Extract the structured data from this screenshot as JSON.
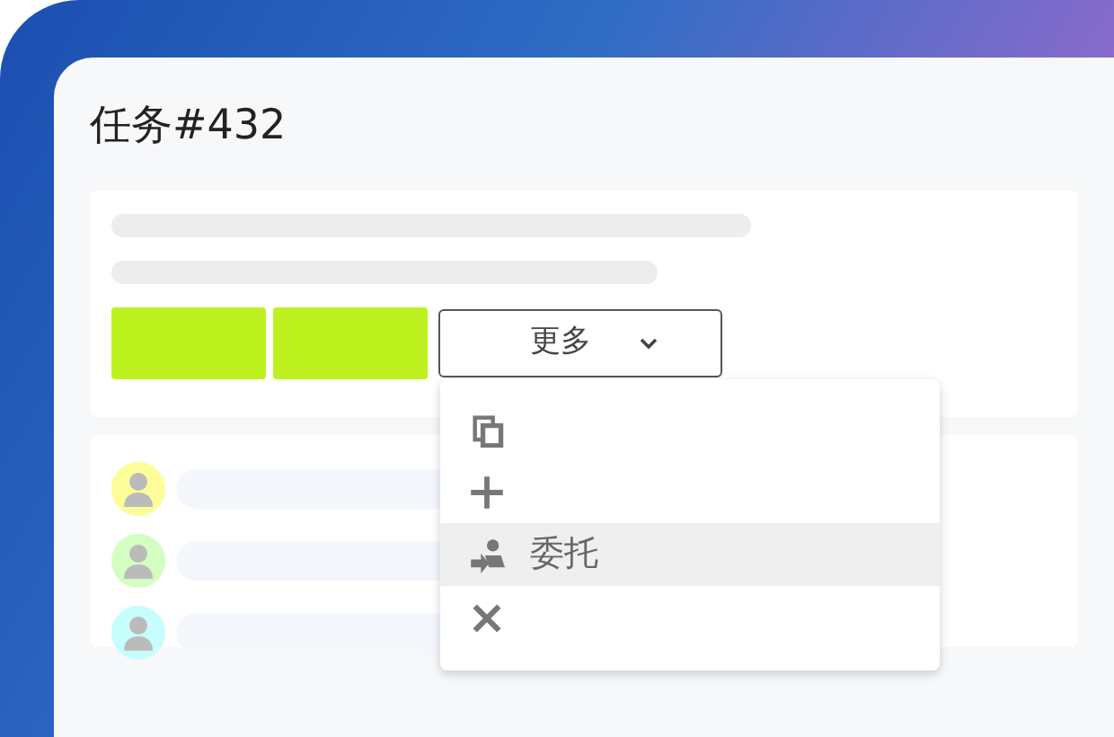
{
  "title": "任务#432",
  "action_buttons": [
    {
      "color": "#bef21f"
    },
    {
      "color": "#bef21f"
    }
  ],
  "more_button": {
    "label": "更多",
    "expanded": true
  },
  "menu": [
    {
      "kind": "copy",
      "selected": false
    },
    {
      "kind": "add",
      "selected": false
    },
    {
      "kind": "delegate",
      "label": "委托",
      "selected": true
    },
    {
      "kind": "close",
      "selected": false
    }
  ],
  "assignees": [
    {
      "color": "#fdfd9a"
    },
    {
      "color": "#d4fdc2"
    },
    {
      "color": "#c6fdfd"
    }
  ]
}
